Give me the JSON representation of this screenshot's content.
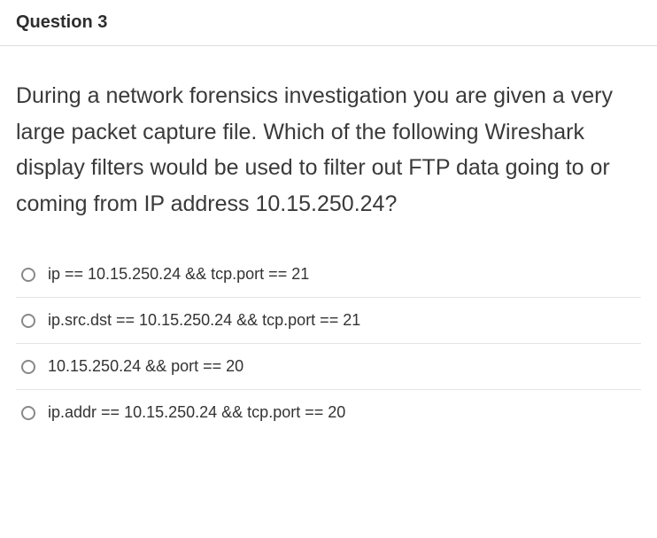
{
  "header": {
    "title": "Question 3"
  },
  "question": {
    "prompt": "During a network forensics investigation you are given a very large packet capture file. Which of the following Wireshark display filters would be used to filter out FTP data going to or coming from IP address 10.15.250.24?"
  },
  "options": [
    {
      "label": "ip == 10.15.250.24 && tcp.port == 21"
    },
    {
      "label": "ip.src.dst == 10.15.250.24 && tcp.port == 21"
    },
    {
      "label": "10.15.250.24 && port == 20"
    },
    {
      "label": "ip.addr == 10.15.250.24 && tcp.port == 20"
    }
  ]
}
